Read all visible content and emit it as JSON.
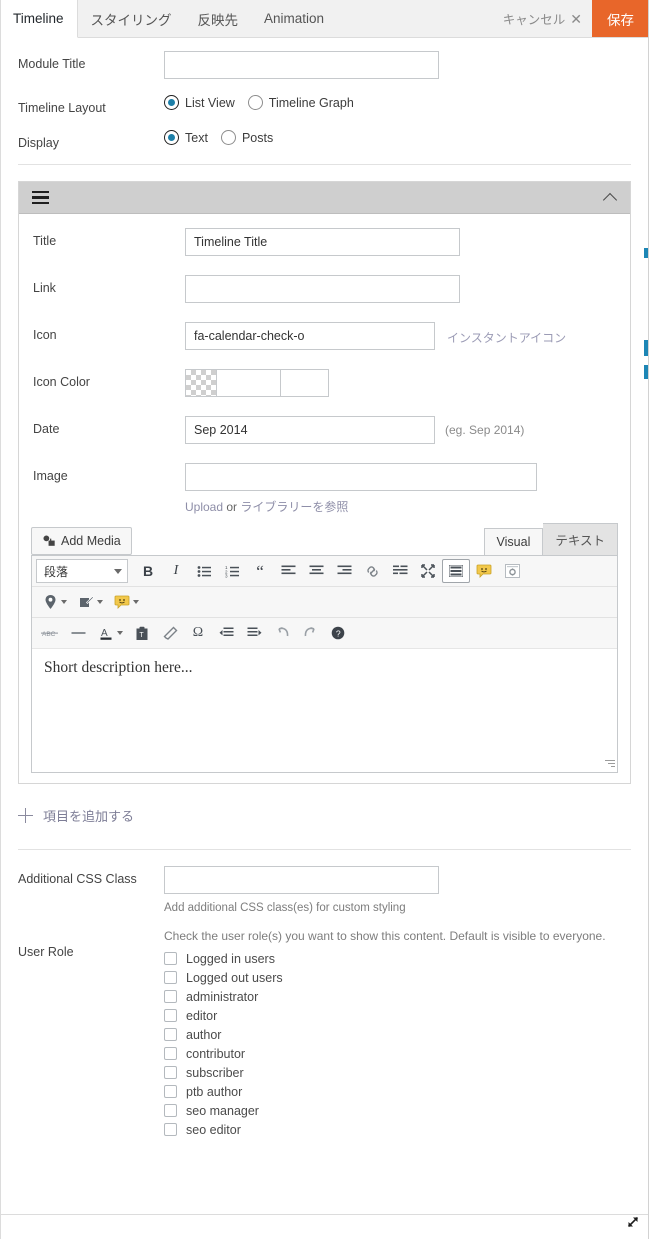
{
  "topbar": {
    "tabs": [
      {
        "label": "Timeline",
        "active": true
      },
      {
        "label": "スタイリング",
        "active": false
      },
      {
        "label": "反映先",
        "active": false
      },
      {
        "label": "Animation",
        "active": false
      }
    ],
    "cancel_label": "キャンセル",
    "cancel_icon": "close-icon",
    "save_label": "保存",
    "accent_color": "#e8662a"
  },
  "general": {
    "module_title": {
      "label": "Module Title",
      "value": "",
      "placeholder": ""
    },
    "timeline_layout": {
      "label": "Timeline Layout",
      "options": [
        {
          "label": "List View",
          "checked": true
        },
        {
          "label": "Timeline Graph",
          "checked": false
        }
      ]
    },
    "display": {
      "label": "Display",
      "options": [
        {
          "label": "Text",
          "checked": true
        },
        {
          "label": "Posts",
          "checked": false
        }
      ]
    }
  },
  "module": {
    "drag_icon": "hamburger-icon",
    "collapse_icon": "chevron-up-icon",
    "title": {
      "label": "Title",
      "value": "Timeline Title"
    },
    "link": {
      "label": "Link",
      "value": ""
    },
    "icon": {
      "label": "Icon",
      "value": "fa-calendar-check-o",
      "instant_link": "インスタントアイコン"
    },
    "icon_color": {
      "label": "Icon Color",
      "value": "",
      "swatch": "transparent-checker"
    },
    "date": {
      "label": "Date",
      "value": "Sep 2014",
      "hint": "(eg. Sep 2014)"
    },
    "image": {
      "label": "Image",
      "value": "",
      "upload_label": "Upload",
      "or_label": "or",
      "library_label": "ライブラリーを参照"
    },
    "editor": {
      "add_media_label": "Add Media",
      "add_media_icon": "media-icon",
      "tabs": [
        {
          "label": "Visual",
          "active": true
        },
        {
          "label": "テキスト",
          "active": false
        }
      ],
      "format_select": "段落",
      "content": "Short description here...",
      "toolbar_row1": [
        "bold-icon",
        "italic-icon",
        "bulleted-list-icon",
        "numbered-list-icon",
        "blockquote-icon",
        "align-left-icon",
        "align-center-icon",
        "align-right-icon",
        "link-icon",
        "read-more-icon",
        "fullscreen-icon",
        "toolbar-toggle-icon",
        "emoji-icon",
        "page-settings-icon"
      ],
      "toolbar_row2": [
        "map-pin-icon",
        "pencil-edit-icon",
        "smiley-icon"
      ],
      "toolbar_row3": [
        "strikethrough-icon",
        "horizontal-rule-icon",
        "text-color-icon",
        "paste-as-text-icon",
        "clear-formatting-icon",
        "special-character-icon",
        "outdent-icon",
        "indent-icon",
        "undo-icon",
        "redo-icon",
        "keyboard-help-icon"
      ]
    }
  },
  "add_item": {
    "label": "項目を追加する",
    "icon": "plus-icon"
  },
  "advanced": {
    "css_class": {
      "label": "Additional CSS Class",
      "value": "",
      "hint": "Add additional CSS class(es) for custom styling"
    },
    "user_role": {
      "label": "User Role",
      "hint": "Check the user role(s) you want to show this content. Default is visible to everyone.",
      "items": [
        {
          "label": "Logged in users",
          "checked": false
        },
        {
          "label": "Logged out users",
          "checked": false
        },
        {
          "label": "administrator",
          "checked": false
        },
        {
          "label": "editor",
          "checked": false
        },
        {
          "label": "author",
          "checked": false
        },
        {
          "label": "contributor",
          "checked": false
        },
        {
          "label": "subscriber",
          "checked": false
        },
        {
          "label": "ptb author",
          "checked": false
        },
        {
          "label": "seo manager",
          "checked": false
        },
        {
          "label": "seo editor",
          "checked": false
        }
      ]
    }
  }
}
